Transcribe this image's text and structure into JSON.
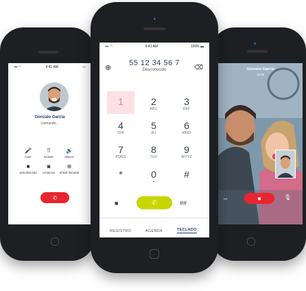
{
  "colors": {
    "brand": "#1f3b70",
    "accent_green": "#c8d600",
    "end_red": "#e8242f",
    "key_highlight": "#fbe1e6"
  },
  "left": {
    "status_time": "9:41 AM",
    "caller_name": "Gonzalo García",
    "call_status": "Llamando...",
    "actions": [
      {
        "icon": "microphone-icon",
        "label": "mute"
      },
      {
        "icon": "keypad-icon",
        "label": "teclado"
      },
      {
        "icon": "speaker-icon",
        "label": "altavoz"
      },
      {
        "icon": "video-icon",
        "label": "videollamada"
      },
      {
        "icon": "contacts-icon",
        "label": "contactos"
      },
      {
        "icon": "add-icon",
        "label": "añadir llamada"
      }
    ]
  },
  "center": {
    "status_time": "9:41 AM",
    "battery": "100%",
    "number": "55 12 34 56 7",
    "caller": "Desconocido",
    "keys": [
      {
        "n": "1",
        "l": ""
      },
      {
        "n": "2",
        "l": "ABC"
      },
      {
        "n": "3",
        "l": "DEF"
      },
      {
        "n": "4",
        "l": "GHI"
      },
      {
        "n": "5",
        "l": "JKL"
      },
      {
        "n": "6",
        "l": "MNO"
      },
      {
        "n": "7",
        "l": "PQRS"
      },
      {
        "n": "8",
        "l": "TUV"
      },
      {
        "n": "9",
        "l": "WXYZ"
      },
      {
        "n": "*",
        "l": ""
      },
      {
        "n": "0",
        "l": "+"
      },
      {
        "n": "#",
        "l": ""
      }
    ],
    "tabs": [
      "REGISTRO",
      "AGENDA",
      "TECLADO"
    ],
    "active_tab": "TECLADO"
  },
  "right": {
    "caller_name": "Gonzalo García",
    "duration": "12:32"
  }
}
